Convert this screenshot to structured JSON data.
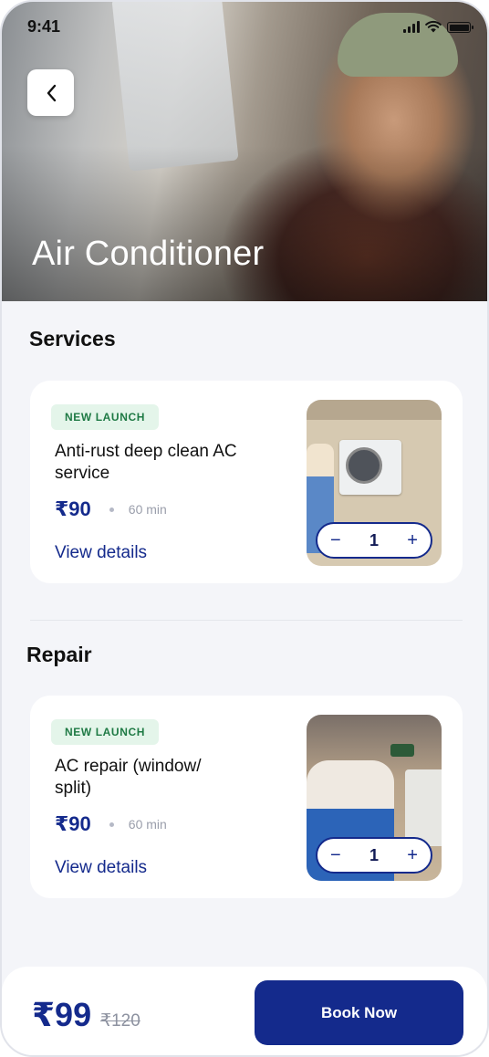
{
  "status_bar": {
    "time": "9:41"
  },
  "hero": {
    "title": "Air Conditioner"
  },
  "sections": [
    {
      "title": "Services",
      "item": {
        "badge": "NEW LAUNCH",
        "name": "Anti-rust deep clean AC service",
        "price": "₹90",
        "duration": "60 min",
        "link": "View details",
        "stepper": {
          "minus": "−",
          "qty": "1",
          "plus": "+"
        }
      }
    },
    {
      "title": "Repair",
      "item": {
        "badge": "NEW LAUNCH",
        "name": "AC repair (window/ split)",
        "price": "₹90",
        "duration": "60 min",
        "link": "View details",
        "stepper": {
          "minus": "−",
          "qty": "1",
          "plus": "+"
        }
      }
    }
  ],
  "footer": {
    "total": "₹99",
    "original_price": "₹120",
    "cta": "Book Now"
  },
  "colors": {
    "primary": "#142a8c",
    "badge_bg": "#e4f5ea",
    "badge_text": "#1f7a45",
    "page_bg": "#f4f5f9"
  },
  "icons": {
    "back": "chevron-left-icon",
    "signal": "cellular-signal-icon",
    "wifi": "wifi-icon",
    "battery": "battery-icon"
  }
}
